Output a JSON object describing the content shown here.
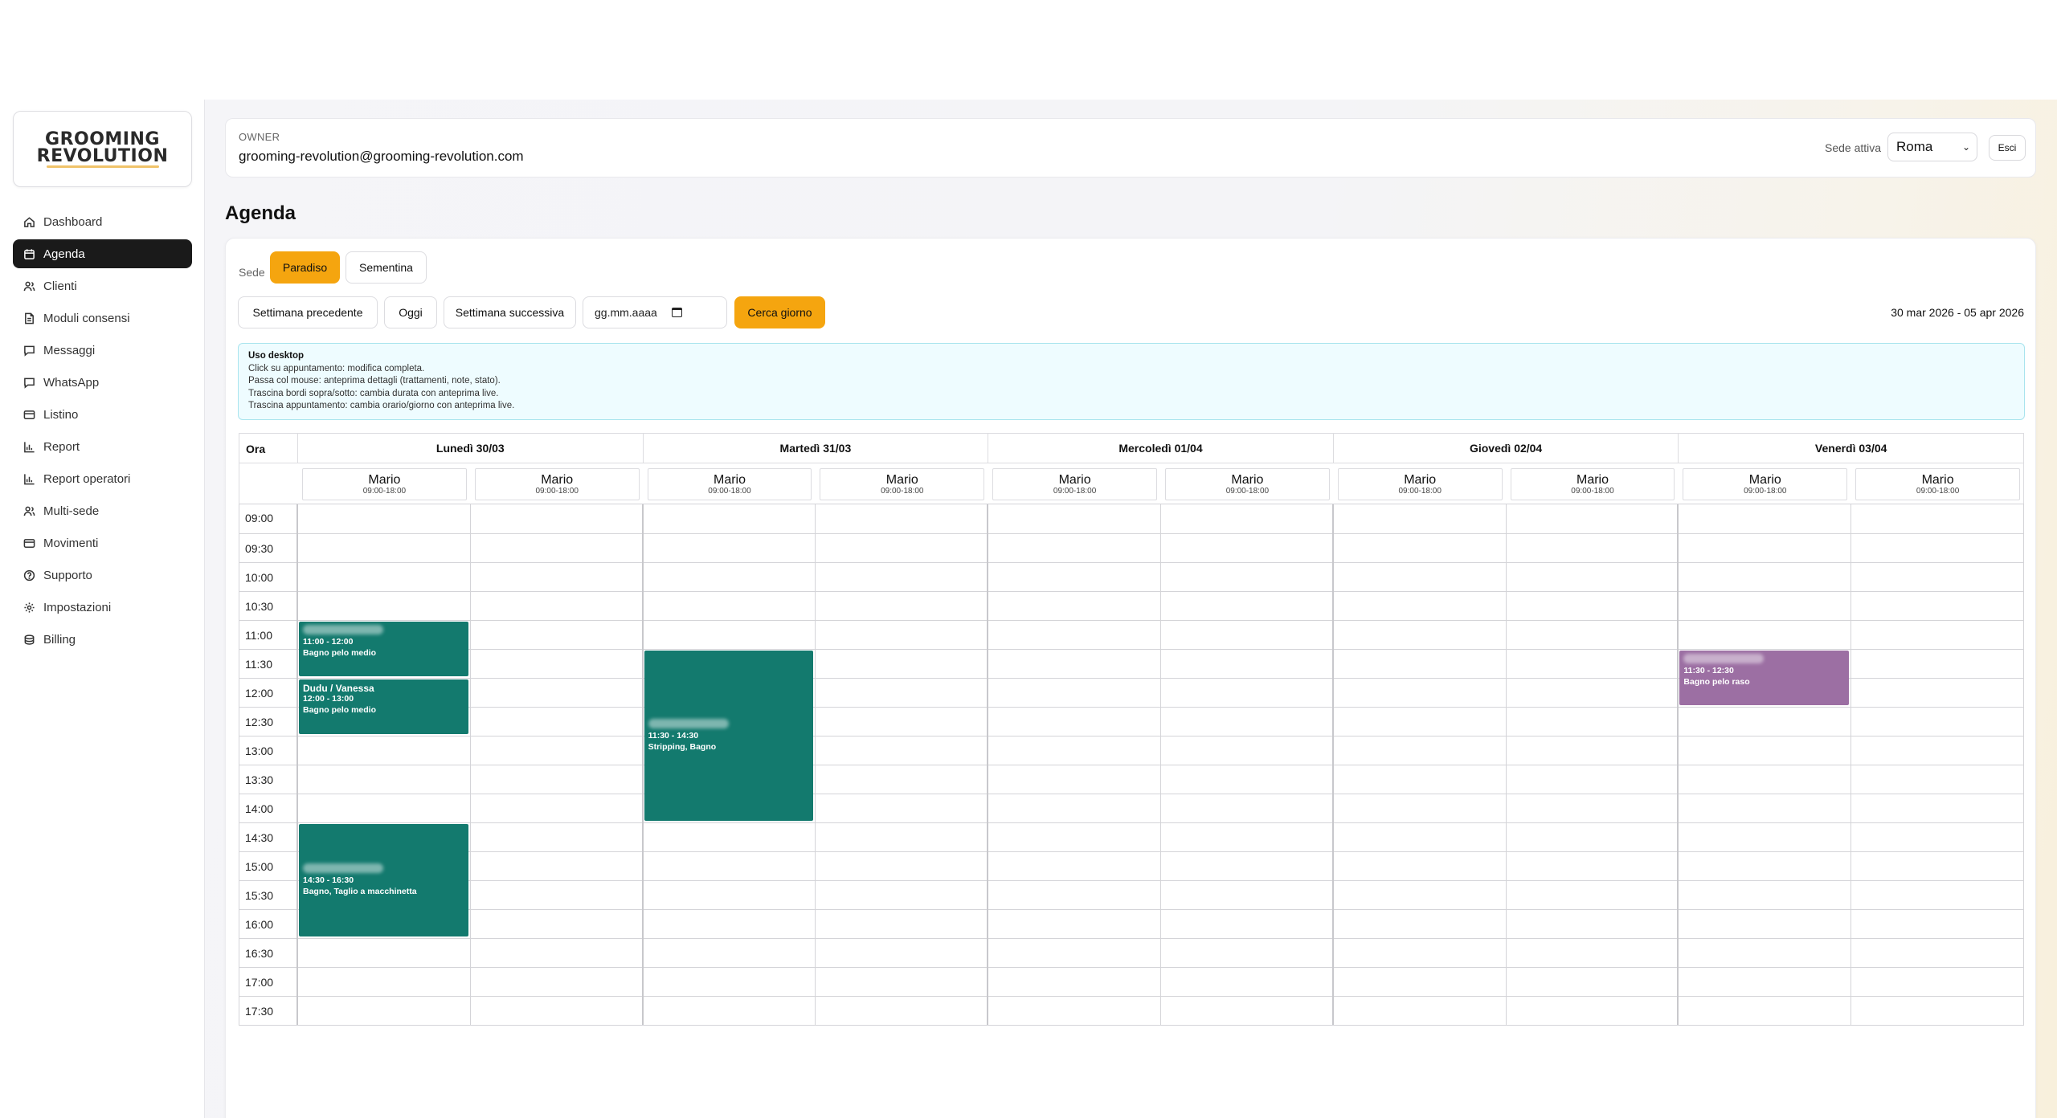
{
  "brand": {
    "line1": "GROOMING",
    "line2": "REVOLUTION"
  },
  "sidebar": {
    "items": [
      {
        "label": "Dashboard",
        "icon": "home-icon"
      },
      {
        "label": "Agenda",
        "icon": "calendar-icon",
        "active": true
      },
      {
        "label": "Clienti",
        "icon": "users-icon"
      },
      {
        "label": "Moduli consensi",
        "icon": "document-icon"
      },
      {
        "label": "Messaggi",
        "icon": "chat-icon"
      },
      {
        "label": "WhatsApp",
        "icon": "chat-icon"
      },
      {
        "label": "Listino",
        "icon": "card-icon"
      },
      {
        "label": "Report",
        "icon": "bar-chart-icon"
      },
      {
        "label": "Report operatori",
        "icon": "bar-chart-icon"
      },
      {
        "label": "Multi-sede",
        "icon": "users-icon"
      },
      {
        "label": "Movimenti",
        "icon": "card-icon"
      },
      {
        "label": "Supporto",
        "icon": "help-icon"
      },
      {
        "label": "Impostazioni",
        "icon": "gear-icon"
      },
      {
        "label": "Billing",
        "icon": "coins-icon"
      }
    ]
  },
  "header": {
    "role": "OWNER",
    "email": "grooming-revolution@grooming-revolution.com",
    "sede_label": "Sede attiva",
    "sede_value": "Roma",
    "logout": "Esci"
  },
  "page": {
    "title": "Agenda"
  },
  "sede_switch": {
    "label": "Sede",
    "options": [
      {
        "label": "Paradiso",
        "active": true
      },
      {
        "label": "Sementina",
        "active": false
      }
    ]
  },
  "controls": {
    "prev": "Settimana precedente",
    "today": "Oggi",
    "next": "Settimana successiva",
    "date_placeholder": "gg.mm.aaaa",
    "search": "Cerca giorno",
    "range": "30 mar 2026 - 05 apr 2026"
  },
  "info": {
    "title": "Uso desktop",
    "lines": [
      "Click su appuntamento: modifica completa.",
      "Passa col mouse: anteprima dettagli (trattamenti, note, stato).",
      "Trascina bordi sopra/sotto: cambia durata con anteprima live.",
      "Trascina appuntamento: cambia orario/giorno con anteprima live."
    ]
  },
  "calendar": {
    "time_header": "Ora",
    "days": [
      "Lunedì 30/03",
      "Martedì 31/03",
      "Mercoledì 01/04",
      "Giovedì 02/04",
      "Venerdì 03/04"
    ],
    "operators": [
      {
        "name": "Mario",
        "hours": "09:00-18:00"
      },
      {
        "name": "Mario",
        "hours": "09:00-18:00"
      }
    ],
    "times": [
      "09:00",
      "09:30",
      "10:00",
      "10:30",
      "11:00",
      "11:30",
      "12:00",
      "12:30",
      "13:00",
      "13:30",
      "14:00",
      "14:30",
      "15:00",
      "15:30",
      "16:00",
      "16:30",
      "17:00",
      "17:30"
    ],
    "appointments": [
      {
        "day": 0,
        "col": 0,
        "start": "11:00",
        "end": "12:00",
        "title": "",
        "time": "11:00 - 12:00",
        "service": "Bagno pelo medio",
        "color": "#137a6e",
        "blurred": true
      },
      {
        "day": 0,
        "col": 0,
        "start": "12:00",
        "end": "13:00",
        "title": "Dudu / Vanessa",
        "time": "12:00 - 13:00",
        "service": "Bagno pelo medio",
        "color": "#137a6e",
        "blurred": false
      },
      {
        "day": 0,
        "col": 0,
        "start": "14:30",
        "end": "16:30",
        "title": "",
        "time": "14:30 - 16:30",
        "service": "Bagno, Taglio a macchinetta",
        "color": "#137a6e",
        "blurred": true
      },
      {
        "day": 1,
        "col": 0,
        "start": "11:30",
        "end": "14:30",
        "title": "",
        "time": "11:30 - 14:30",
        "service": "Stripping, Bagno",
        "color": "#137a6e",
        "blurred": true
      },
      {
        "day": 4,
        "col": 0,
        "start": "11:30",
        "end": "12:30",
        "title": "",
        "time": "11:30 - 12:30",
        "service": "Bagno pelo raso",
        "color": "#9c6fa3",
        "blurred": true
      }
    ]
  }
}
